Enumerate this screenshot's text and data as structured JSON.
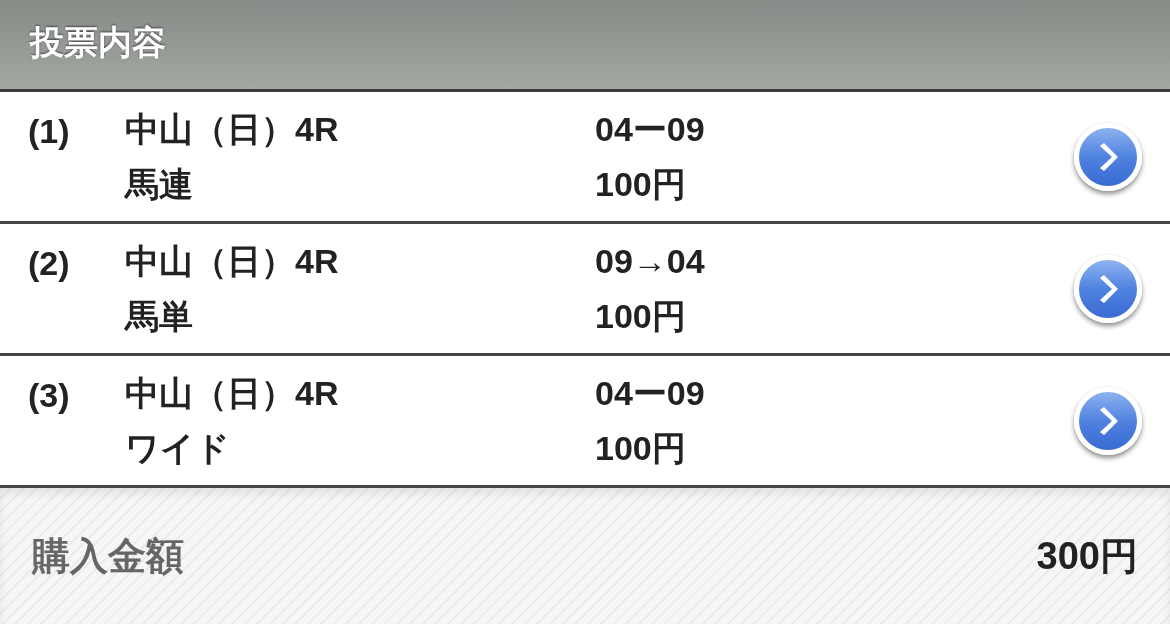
{
  "header": {
    "title": "投票内容"
  },
  "bets": [
    {
      "number": "(1)",
      "race": "中山（日）4R",
      "bet_type": "馬連",
      "combination": "04ー09",
      "amount": "100円"
    },
    {
      "number": "(2)",
      "race": "中山（日）4R",
      "bet_type": "馬単",
      "combination": "09→04",
      "amount": "100円"
    },
    {
      "number": "(3)",
      "race": "中山（日）4R",
      "bet_type": "ワイド",
      "combination": "04ー09",
      "amount": "100円"
    }
  ],
  "total": {
    "label": "購入金額",
    "amount": "300円"
  }
}
